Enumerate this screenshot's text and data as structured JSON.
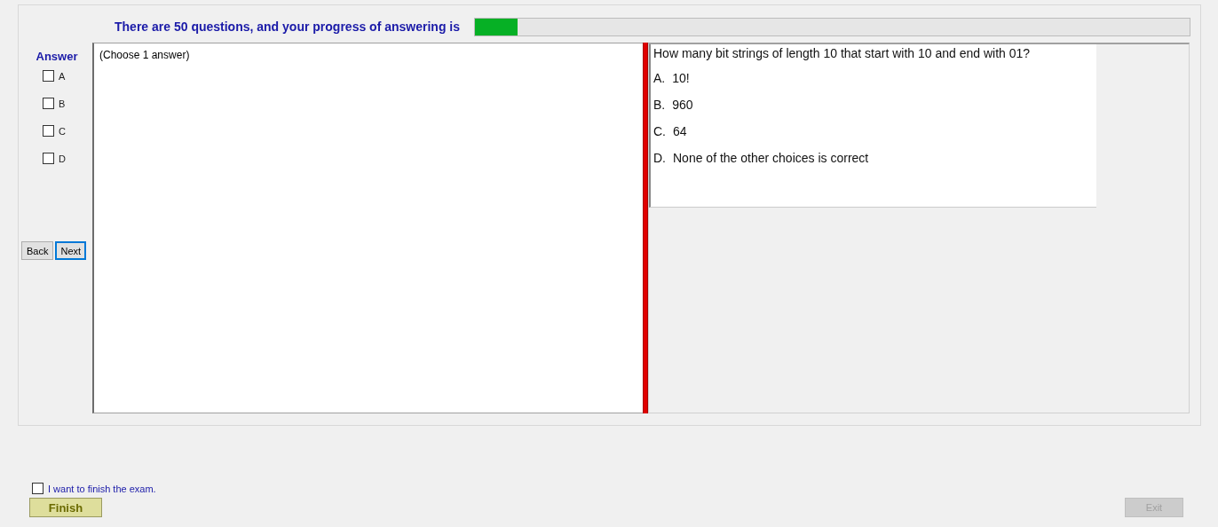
{
  "header": {
    "text": "There are 50 questions, and your progress of answering is",
    "progress": {
      "level": 0.06
    }
  },
  "answer_panel": {
    "title": "Answer",
    "options": [
      {
        "label": "A",
        "checked": false
      },
      {
        "label": "B",
        "checked": false
      },
      {
        "label": "C",
        "checked": false
      },
      {
        "label": "D",
        "checked": false
      }
    ],
    "buttons": [
      {
        "label": "Back",
        "focused": false
      },
      {
        "label": "Next",
        "focused": true
      }
    ]
  },
  "answer_hint": "(Choose 1 answer)",
  "question": {
    "text": "How many bit strings of length 10 that start with 10 and end with 01?",
    "choices": [
      {
        "letter": "A.",
        "text": "10!"
      },
      {
        "letter": "B.",
        "text": "960"
      },
      {
        "letter": "C.",
        "text": "64"
      },
      {
        "letter": "D.",
        "text": "None of the other choices is correct"
      }
    ]
  },
  "footer": {
    "finish_checkbox": {
      "label": "I want to finish the exam.",
      "checked": false
    },
    "finish_button": {
      "label": "Finish",
      "disabled": false
    },
    "exit_button": {
      "label": "Exit",
      "disabled": true
    }
  }
}
